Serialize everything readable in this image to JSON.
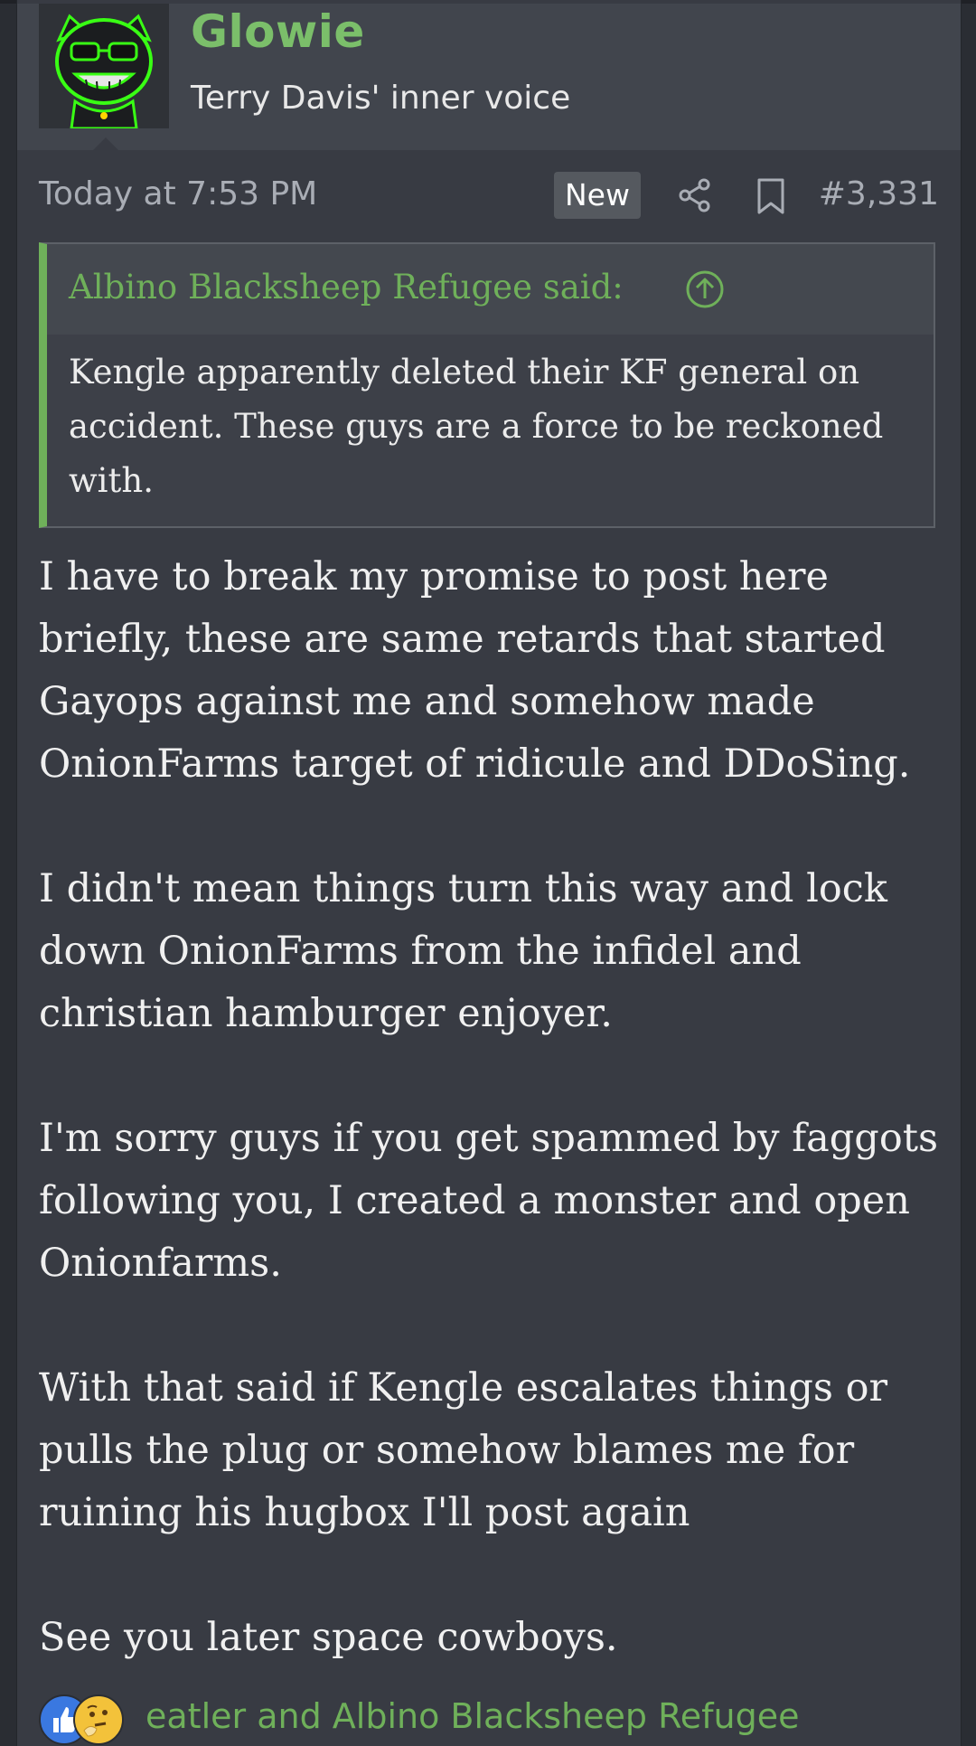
{
  "user": {
    "name": "Glowie",
    "title": "Terry Davis' inner voice",
    "avatar_icon": "glowing-cat-avatar-icon"
  },
  "meta": {
    "timestamp": "Today at 7:53 PM",
    "new_badge": "New",
    "share_icon": "share-icon",
    "bookmark_icon": "bookmark-icon",
    "post_number": "#3,331"
  },
  "quote": {
    "author": "Albino Blacksheep Refugee said:",
    "text": "Kengle apparently deleted their KF general on accident. These guys are a force to be reckoned with."
  },
  "body": {
    "paragraphs": [
      "I have to break my promise to post here briefly, these are same retards that started Gayops against me and somehow made OnionFarms target of ridicule and DDoSing.",
      "I didn't mean things turn this way and lock down OnionFarms from the infidel and christian hamburger enjoyer.",
      "I'm sorry guys if you get spammed by faggots following you, I created a monster and open Onionfarms.",
      "With that said if Kengle escalates things or pulls the plug or somehow blames me for ruining his hugbox I'll post again",
      "See you later space cowboys."
    ]
  },
  "reactions": {
    "icons": [
      "thumbs-up-icon",
      "thinking-face-icon"
    ],
    "text": "eatler and Albino Blacksheep Refugee",
    "colors": {
      "like": "#3a78e0",
      "think": "#f3c23a"
    }
  },
  "colors": {
    "accent_green": "#6fb05a",
    "username_green": "#7bbf6a",
    "background": "#383b43"
  }
}
